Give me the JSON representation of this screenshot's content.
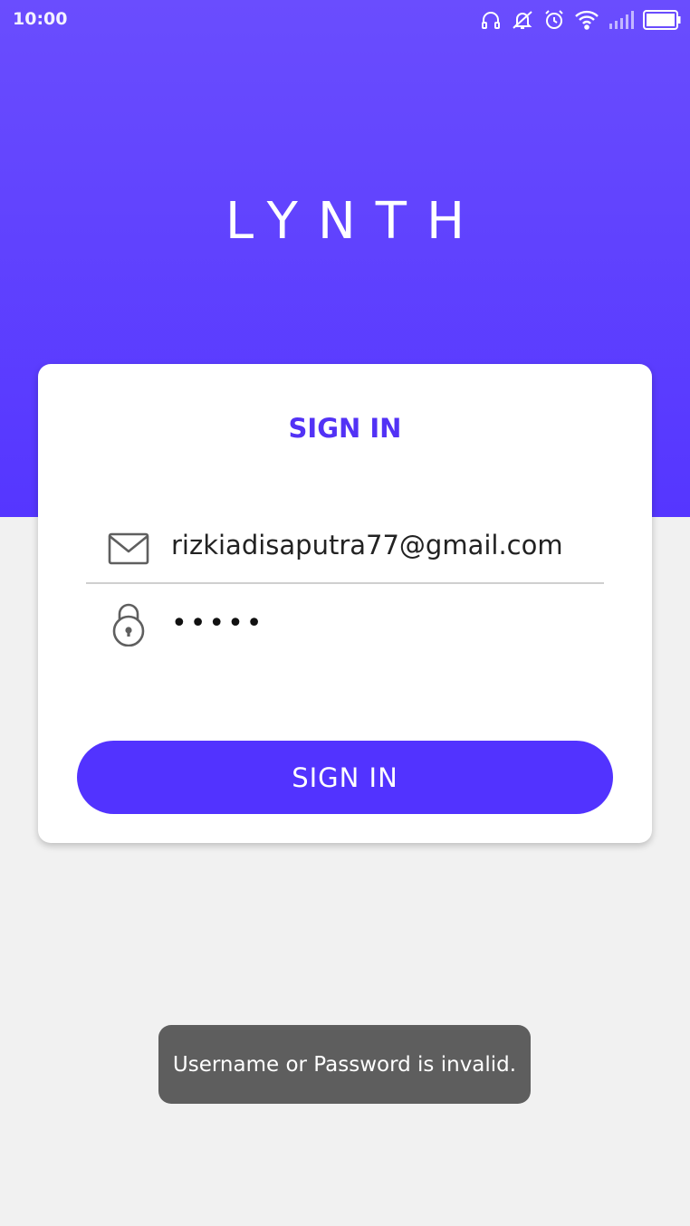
{
  "status_bar": {
    "time": "10:00",
    "icons": [
      "headphones-icon",
      "muted-bell-icon",
      "alarm-icon",
      "wifi-icon",
      "signal-icon",
      "battery-icon"
    ]
  },
  "app": {
    "logo": "LYNTH",
    "brand_color": "#5233ff"
  },
  "login_card": {
    "title": "SIGN IN",
    "email": {
      "icon": "mail-icon",
      "value": "rizkiadisaputra77@gmail.com"
    },
    "password": {
      "icon": "lock-icon",
      "value": "•••••"
    },
    "submit_label": "SIGN IN"
  },
  "toast": {
    "message": "Username or Password is invalid."
  }
}
